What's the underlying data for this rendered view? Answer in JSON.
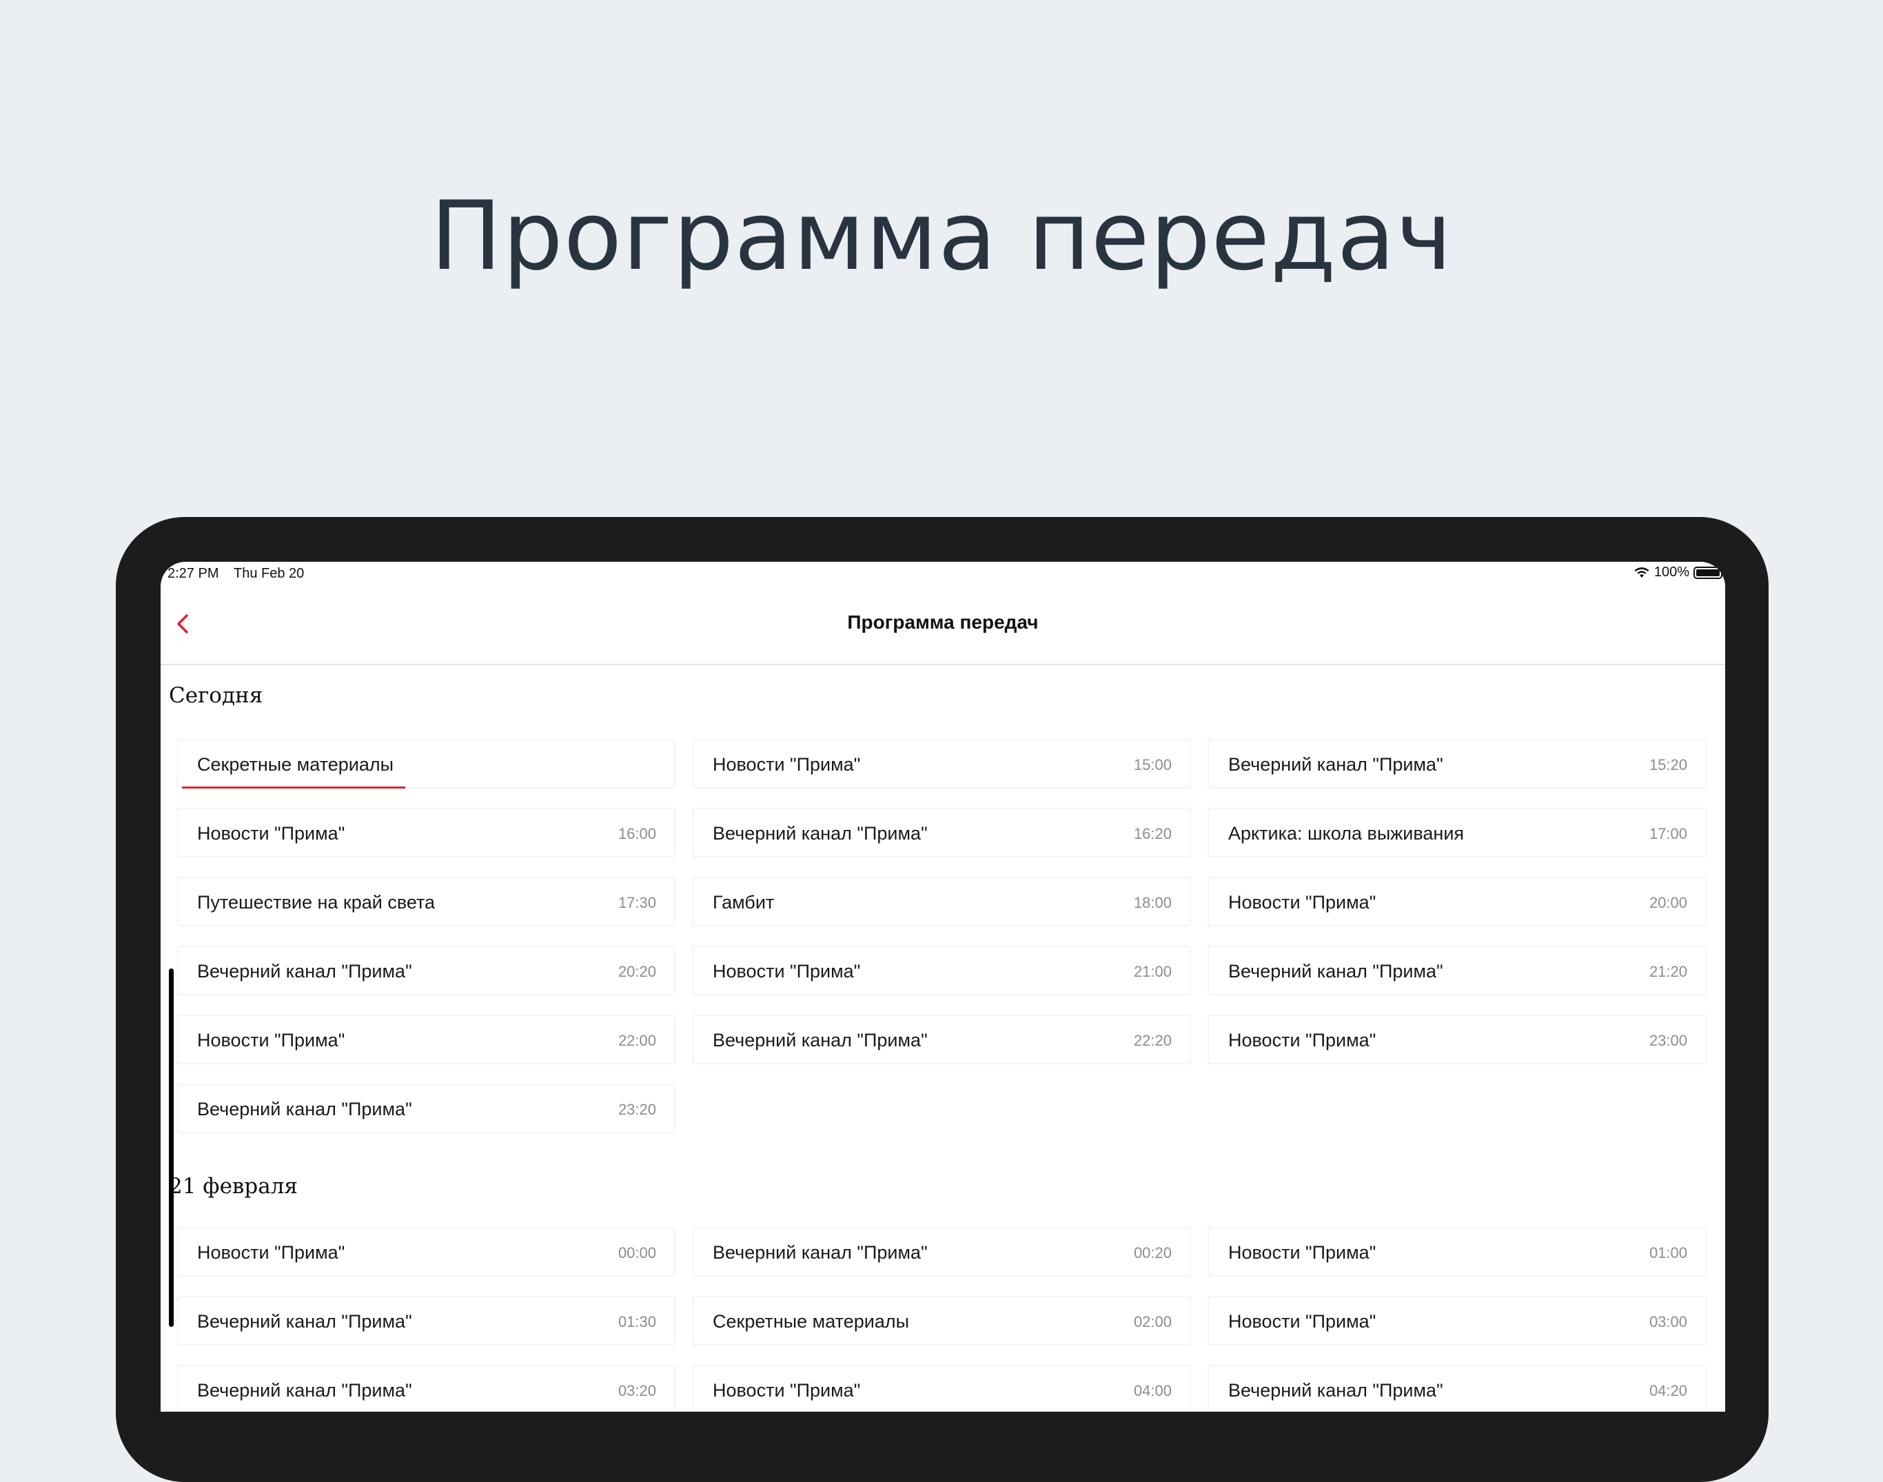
{
  "hero": {
    "title": "Программа передач"
  },
  "status_bar": {
    "time": "2:27 PM",
    "date": "Thu Feb 20",
    "battery": "100%"
  },
  "nav": {
    "title": "Программа передач"
  },
  "sections": [
    {
      "title": "Сегодня",
      "items": [
        {
          "name": "Секретные материалы",
          "time": "",
          "current": true
        },
        {
          "name": "Новости \"Прима\"",
          "time": "15:00"
        },
        {
          "name": "Вечерний канал \"Прима\"",
          "time": "15:20"
        },
        {
          "name": "Новости \"Прима\"",
          "time": "16:00"
        },
        {
          "name": "Вечерний канал \"Прима\"",
          "time": "16:20"
        },
        {
          "name": "Арктика: школа выживания",
          "time": "17:00"
        },
        {
          "name": "Путешествие на край света",
          "time": "17:30"
        },
        {
          "name": "Гамбит",
          "time": "18:00"
        },
        {
          "name": "Новости \"Прима\"",
          "time": "20:00"
        },
        {
          "name": "Вечерний канал \"Прима\"",
          "time": "20:20"
        },
        {
          "name": "Новости \"Прима\"",
          "time": "21:00"
        },
        {
          "name": "Вечерний канал \"Прима\"",
          "time": "21:20"
        },
        {
          "name": "Новости \"Прима\"",
          "time": "22:00"
        },
        {
          "name": "Вечерний канал \"Прима\"",
          "time": "22:20"
        },
        {
          "name": "Новости \"Прима\"",
          "time": "23:00"
        },
        {
          "name": "Вечерний канал \"Прима\"",
          "time": "23:20"
        }
      ]
    },
    {
      "title": "21 февраля",
      "items": [
        {
          "name": "Новости \"Прима\"",
          "time": "00:00"
        },
        {
          "name": "Вечерний канал \"Прима\"",
          "time": "00:20"
        },
        {
          "name": "Новости \"Прима\"",
          "time": "01:00"
        },
        {
          "name": "Вечерний канал \"Прима\"",
          "time": "01:30"
        },
        {
          "name": "Секретные материалы",
          "time": "02:00"
        },
        {
          "name": "Новости \"Прима\"",
          "time": "03:00"
        },
        {
          "name": "Вечерний канал \"Прима\"",
          "time": "03:20"
        },
        {
          "name": "Новости \"Прима\"",
          "time": "04:00"
        },
        {
          "name": "Вечерний канал \"Прима\"",
          "time": "04:20"
        }
      ]
    }
  ],
  "colors": {
    "accent": "#d9252e",
    "background": "#ebeff3",
    "device": "#1c1c1c"
  }
}
